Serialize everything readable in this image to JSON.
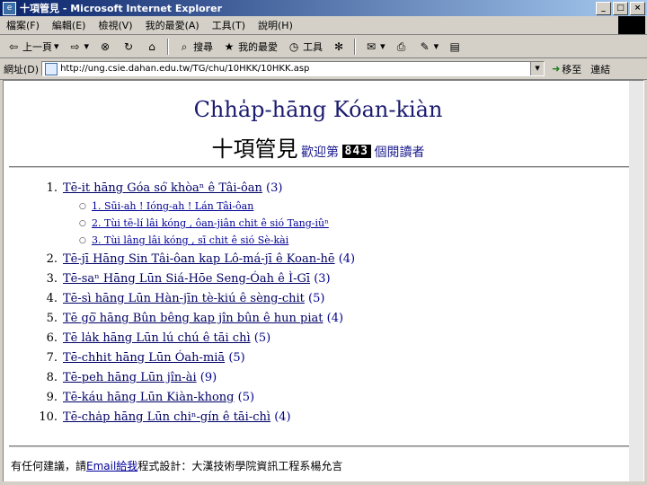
{
  "window": {
    "title": "十項管見 - Microsoft Internet Explorer"
  },
  "menu": [
    "檔案(F)",
    "編輯(E)",
    "檢視(V)",
    "我的最愛(A)",
    "工具(T)",
    "說明(H)"
  ],
  "toolbar": {
    "back": "上一頁",
    "search": "搜尋",
    "favorites": "我的最愛",
    "tools": "工具"
  },
  "address": {
    "label": "網址(D)",
    "url": "http://ung.csie.dahan.edu.tw/TG/chu/10HKK/10HKK.asp",
    "go": "移至",
    "links": "連結"
  },
  "page": {
    "title": "Chha̍p-hāng Kóan-kiàn",
    "subtitle": "十項管見",
    "welcome_pre": "歡迎第",
    "counter": "843",
    "welcome_post": "個閱讀者",
    "items": [
      {
        "num": "1.",
        "text": "Tē-it hāng Góa só͘ khòaⁿ ê Tâi-ôan",
        "count": "(3)",
        "subs": [
          "1. Sūi-ah ! Ióng-ah ! Lán Tâi-ôan",
          "2. Tùi tē-lí lâi kóng , ôan-jiân chit ê sió Tang-iûⁿ",
          "3. Tùi lâng lâi kóng , sī chit ê sió Sè-kài"
        ]
      },
      {
        "num": "2.",
        "text": "Tē-jī Hāng Sin Tâi-ôan kap Lô-má-jī ê Koan-hē",
        "count": "(4)",
        "subs": []
      },
      {
        "num": "3.",
        "text": "Tē-saⁿ Hāng Lūn Siá-Hōe Seng-Óah ê Ì-Gī",
        "count": "(3)",
        "subs": []
      },
      {
        "num": "4.",
        "text": "Tē-sì hāng Lūn Hàn-jīn tè-kiú ê sèng-chit",
        "count": "(5)",
        "subs": []
      },
      {
        "num": "5.",
        "text": "Tē gō͘ hāng Bûn bêng kap jîn bûn ê hun piat",
        "count": "(4)",
        "subs": []
      },
      {
        "num": "6.",
        "text": "Tē la̍k hāng Lūn lú chú ê tāi chì",
        "count": "(5)",
        "subs": []
      },
      {
        "num": "7.",
        "text": "Tē-chhit hāng Lūn Óah-miā",
        "count": "(5)",
        "subs": []
      },
      {
        "num": "8.",
        "text": "Tē-peh hāng Lūn jîn-ài",
        "count": "(9)",
        "subs": []
      },
      {
        "num": "9.",
        "text": "Tē-káu hāng Lūn Kiàn-khong",
        "count": "(5)",
        "subs": []
      },
      {
        "num": "10.",
        "text": "Tē-cha̍p hāng Lūn chiⁿ-gín ê tāi-chì",
        "count": "(4)",
        "subs": []
      }
    ],
    "footer_pre": "有任何建議，請",
    "footer_link": "Email給我",
    "footer_post": "程式設計：大漢技術學院資訊工程系楊允言"
  }
}
